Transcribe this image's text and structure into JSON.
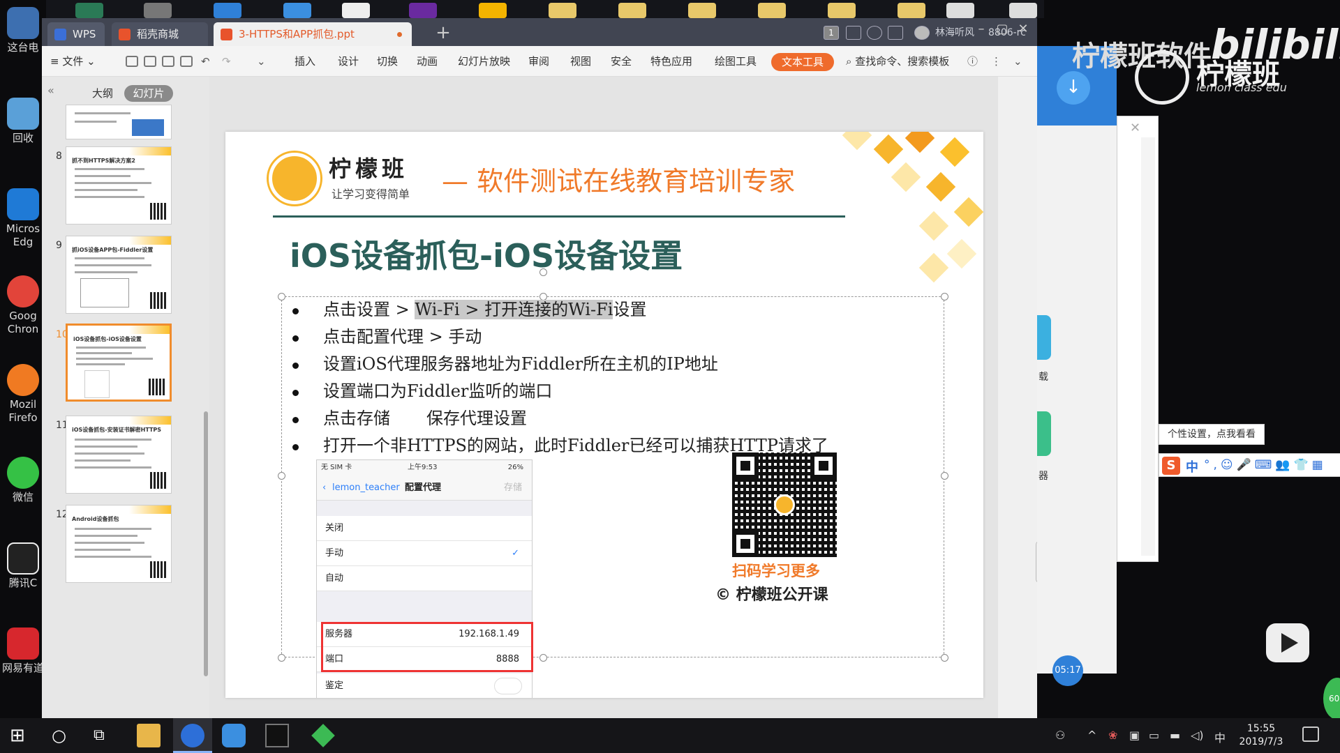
{
  "desktop": {
    "icons": [
      {
        "label": "这台电",
        "color": "#3d6fb0"
      },
      {
        "label": "回收",
        "color": "#5aa0d8"
      },
      {
        "label": "Micros\nEdg",
        "color": "#1f7ad6"
      },
      {
        "label": "Goog\nChron",
        "color": "#e2443a"
      },
      {
        "label": "Mozil\nFirefo",
        "color": "#f07a22"
      },
      {
        "label": "微信",
        "color": "#35c145"
      },
      {
        "label": "腾讯C",
        "color": "#222222"
      },
      {
        "label": "网易有道",
        "color": "#d7272d"
      }
    ]
  },
  "window": {
    "tabs": [
      {
        "label": "WPS",
        "icon": "wps-logo-icon"
      },
      {
        "label": "稻壳商城",
        "icon": "docer-icon"
      },
      {
        "label": "3-HTTPS和APP抓包.ppt",
        "icon": "ppt-file-icon"
      }
    ],
    "user_name": "林海听风",
    "build_label": "8806-rc",
    "page_badge": "1"
  },
  "menubar": {
    "file": "文件",
    "items": [
      "插入",
      "设计",
      "切换",
      "动画",
      "幻灯片放映",
      "审阅",
      "视图",
      "安全",
      "特色应用",
      "绘图工具"
    ],
    "active": "文本工具",
    "search": "查找命令、搜索模板",
    "accent": "#ef6b2c"
  },
  "sidebar": {
    "tab_outline": "大纲",
    "tab_slides": "幻灯片",
    "thumbnails": [
      {
        "number": "",
        "title": ""
      },
      {
        "number": "8",
        "title": "抓不到HTTPS解决方案2"
      },
      {
        "number": "9",
        "title": "抓iOS设备APP包-Fiddler设置"
      },
      {
        "number": "10",
        "title": "iOS设备抓包-iOS设备设置",
        "selected": true
      },
      {
        "number": "11",
        "title": "iOS设备抓包-安装证书解密HTTPS"
      },
      {
        "number": "12",
        "title": "Android设备抓包"
      }
    ]
  },
  "slide": {
    "brand_name": "柠檬班",
    "brand_sub": "让学习变得简单",
    "slogan": "— 软件测试在线教育培训专家",
    "title": "iOS设备抓包-iOS设备设置",
    "bullets": [
      {
        "pre": "点击设置 > ",
        "hl": "Wi-Fi > 打开连接的Wi-Fi",
        "post": "设置"
      },
      {
        "pre": "点击配置代理 > 手动",
        "hl": "",
        "post": ""
      },
      {
        "pre": "设置iOS代理服务器地址为Fiddler所在主机的IP地址",
        "hl": "",
        "post": ""
      },
      {
        "pre": "设置端口为Fiddler监听的端口",
        "hl": "",
        "post": ""
      },
      {
        "pre": "点击存储",
        "hl": "",
        "post": "保存代理设置"
      },
      {
        "pre": "打开一个非HTTPS的网站，此时Fiddler已经可以捕获HTTP请求了",
        "hl": "",
        "post": ""
      }
    ],
    "ios": {
      "carrier": "无 SIM 卡",
      "time": "上午9:53",
      "battery": "26%",
      "back": "lemon_teacher",
      "nav_title": "配置代理",
      "save": "存储",
      "opt_off": "关闭",
      "opt_manual": "手动",
      "opt_auto": "自动",
      "server_label": "服务器",
      "server_value": "192.168.1.49",
      "port_label": "端口",
      "port_value": "8888",
      "auth_label": "鉴定"
    },
    "qr_caption": "扫码学习更多",
    "copyright": "© 柠檬班公开课"
  },
  "overlay": {
    "brand_faded": "柠檬班软件",
    "bilibili": "bilibili",
    "lemon_name": "柠檬班",
    "lemon_edu": "lemon class edu",
    "ime_tip": "个性设置，点我看看",
    "ime_mode": "中",
    "ime_icons": "°,☺🎤⌨👥👕▦",
    "timer": "05:17",
    "side_label_1": "载",
    "side_label_2": "器",
    "badge_value": "60"
  },
  "taskbar": {
    "time": "15:55",
    "date": "2019/7/3",
    "ime": "中"
  }
}
